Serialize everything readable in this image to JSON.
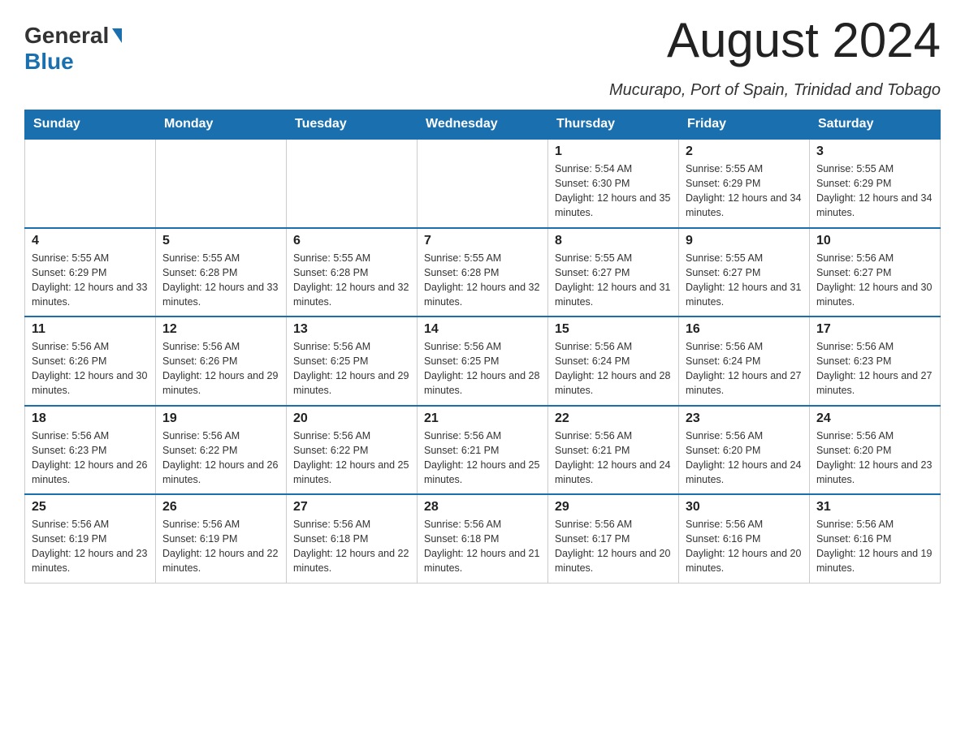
{
  "header": {
    "logo_general": "General",
    "logo_blue": "Blue",
    "month_title": "August 2024",
    "location": "Mucurapo, Port of Spain, Trinidad and Tobago"
  },
  "calendar": {
    "weekdays": [
      "Sunday",
      "Monday",
      "Tuesday",
      "Wednesday",
      "Thursday",
      "Friday",
      "Saturday"
    ],
    "weeks": [
      [
        {
          "day": "",
          "info": ""
        },
        {
          "day": "",
          "info": ""
        },
        {
          "day": "",
          "info": ""
        },
        {
          "day": "",
          "info": ""
        },
        {
          "day": "1",
          "info": "Sunrise: 5:54 AM\nSunset: 6:30 PM\nDaylight: 12 hours and 35 minutes."
        },
        {
          "day": "2",
          "info": "Sunrise: 5:55 AM\nSunset: 6:29 PM\nDaylight: 12 hours and 34 minutes."
        },
        {
          "day": "3",
          "info": "Sunrise: 5:55 AM\nSunset: 6:29 PM\nDaylight: 12 hours and 34 minutes."
        }
      ],
      [
        {
          "day": "4",
          "info": "Sunrise: 5:55 AM\nSunset: 6:29 PM\nDaylight: 12 hours and 33 minutes."
        },
        {
          "day": "5",
          "info": "Sunrise: 5:55 AM\nSunset: 6:28 PM\nDaylight: 12 hours and 33 minutes."
        },
        {
          "day": "6",
          "info": "Sunrise: 5:55 AM\nSunset: 6:28 PM\nDaylight: 12 hours and 32 minutes."
        },
        {
          "day": "7",
          "info": "Sunrise: 5:55 AM\nSunset: 6:28 PM\nDaylight: 12 hours and 32 minutes."
        },
        {
          "day": "8",
          "info": "Sunrise: 5:55 AM\nSunset: 6:27 PM\nDaylight: 12 hours and 31 minutes."
        },
        {
          "day": "9",
          "info": "Sunrise: 5:55 AM\nSunset: 6:27 PM\nDaylight: 12 hours and 31 minutes."
        },
        {
          "day": "10",
          "info": "Sunrise: 5:56 AM\nSunset: 6:27 PM\nDaylight: 12 hours and 30 minutes."
        }
      ],
      [
        {
          "day": "11",
          "info": "Sunrise: 5:56 AM\nSunset: 6:26 PM\nDaylight: 12 hours and 30 minutes."
        },
        {
          "day": "12",
          "info": "Sunrise: 5:56 AM\nSunset: 6:26 PM\nDaylight: 12 hours and 29 minutes."
        },
        {
          "day": "13",
          "info": "Sunrise: 5:56 AM\nSunset: 6:25 PM\nDaylight: 12 hours and 29 minutes."
        },
        {
          "day": "14",
          "info": "Sunrise: 5:56 AM\nSunset: 6:25 PM\nDaylight: 12 hours and 28 minutes."
        },
        {
          "day": "15",
          "info": "Sunrise: 5:56 AM\nSunset: 6:24 PM\nDaylight: 12 hours and 28 minutes."
        },
        {
          "day": "16",
          "info": "Sunrise: 5:56 AM\nSunset: 6:24 PM\nDaylight: 12 hours and 27 minutes."
        },
        {
          "day": "17",
          "info": "Sunrise: 5:56 AM\nSunset: 6:23 PM\nDaylight: 12 hours and 27 minutes."
        }
      ],
      [
        {
          "day": "18",
          "info": "Sunrise: 5:56 AM\nSunset: 6:23 PM\nDaylight: 12 hours and 26 minutes."
        },
        {
          "day": "19",
          "info": "Sunrise: 5:56 AM\nSunset: 6:22 PM\nDaylight: 12 hours and 26 minutes."
        },
        {
          "day": "20",
          "info": "Sunrise: 5:56 AM\nSunset: 6:22 PM\nDaylight: 12 hours and 25 minutes."
        },
        {
          "day": "21",
          "info": "Sunrise: 5:56 AM\nSunset: 6:21 PM\nDaylight: 12 hours and 25 minutes."
        },
        {
          "day": "22",
          "info": "Sunrise: 5:56 AM\nSunset: 6:21 PM\nDaylight: 12 hours and 24 minutes."
        },
        {
          "day": "23",
          "info": "Sunrise: 5:56 AM\nSunset: 6:20 PM\nDaylight: 12 hours and 24 minutes."
        },
        {
          "day": "24",
          "info": "Sunrise: 5:56 AM\nSunset: 6:20 PM\nDaylight: 12 hours and 23 minutes."
        }
      ],
      [
        {
          "day": "25",
          "info": "Sunrise: 5:56 AM\nSunset: 6:19 PM\nDaylight: 12 hours and 23 minutes."
        },
        {
          "day": "26",
          "info": "Sunrise: 5:56 AM\nSunset: 6:19 PM\nDaylight: 12 hours and 22 minutes."
        },
        {
          "day": "27",
          "info": "Sunrise: 5:56 AM\nSunset: 6:18 PM\nDaylight: 12 hours and 22 minutes."
        },
        {
          "day": "28",
          "info": "Sunrise: 5:56 AM\nSunset: 6:18 PM\nDaylight: 12 hours and 21 minutes."
        },
        {
          "day": "29",
          "info": "Sunrise: 5:56 AM\nSunset: 6:17 PM\nDaylight: 12 hours and 20 minutes."
        },
        {
          "day": "30",
          "info": "Sunrise: 5:56 AM\nSunset: 6:16 PM\nDaylight: 12 hours and 20 minutes."
        },
        {
          "day": "31",
          "info": "Sunrise: 5:56 AM\nSunset: 6:16 PM\nDaylight: 12 hours and 19 minutes."
        }
      ]
    ]
  }
}
